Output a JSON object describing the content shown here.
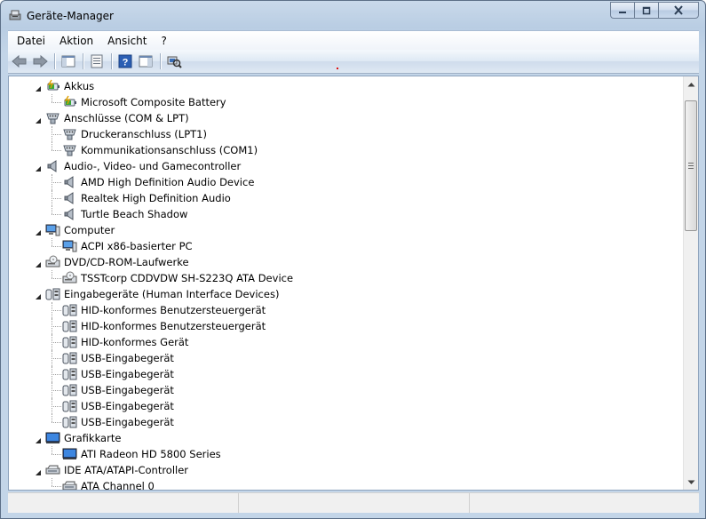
{
  "window": {
    "title": "Geräte-Manager"
  },
  "menu": [
    "Datei",
    "Aktion",
    "Ansicht",
    "?"
  ],
  "toolbar": [
    "back-icon",
    "forward-icon",
    "show-hide-console-tree-icon",
    "properties-icon",
    "help-icon",
    "show-action-pane-icon",
    "scan-hardware-icon"
  ],
  "tree": [
    {
      "label": "Akkus",
      "level": 0,
      "expanded": true,
      "icon": "battery"
    },
    {
      "label": "Microsoft Composite Battery",
      "level": 1,
      "icon": "battery"
    },
    {
      "label": "Anschlüsse (COM & LPT)",
      "level": 0,
      "expanded": true,
      "icon": "port"
    },
    {
      "label": "Druckeranschluss (LPT1)",
      "level": 1,
      "icon": "port"
    },
    {
      "label": "Kommunikationsanschluss (COM1)",
      "level": 1,
      "icon": "port"
    },
    {
      "label": "Audio-, Video- und Gamecontroller",
      "level": 0,
      "expanded": true,
      "icon": "speaker"
    },
    {
      "label": "AMD High Definition Audio Device",
      "level": 1,
      "icon": "speaker"
    },
    {
      "label": "Realtek High Definition Audio",
      "level": 1,
      "icon": "speaker"
    },
    {
      "label": "Turtle Beach Shadow",
      "level": 1,
      "icon": "speaker"
    },
    {
      "label": "Computer",
      "level": 0,
      "expanded": true,
      "icon": "computer"
    },
    {
      "label": "ACPI x86-basierter PC",
      "level": 1,
      "icon": "computer"
    },
    {
      "label": "DVD/CD-ROM-Laufwerke",
      "level": 0,
      "expanded": true,
      "icon": "drive"
    },
    {
      "label": "TSSTcorp CDDVDW SH-S223Q ATA Device",
      "level": 1,
      "icon": "drive"
    },
    {
      "label": "Eingabegeräte (Human Interface Devices)",
      "level": 0,
      "expanded": true,
      "icon": "hid"
    },
    {
      "label": "HID-konformes Benutzersteuergerät",
      "level": 1,
      "icon": "hid"
    },
    {
      "label": "HID-konformes Benutzersteuergerät",
      "level": 1,
      "icon": "hid"
    },
    {
      "label": "HID-konformes Gerät",
      "level": 1,
      "icon": "hid"
    },
    {
      "label": "USB-Eingabegerät",
      "level": 1,
      "icon": "hid"
    },
    {
      "label": "USB-Eingabegerät",
      "level": 1,
      "icon": "hid"
    },
    {
      "label": "USB-Eingabegerät",
      "level": 1,
      "icon": "hid"
    },
    {
      "label": "USB-Eingabegerät",
      "level": 1,
      "icon": "hid"
    },
    {
      "label": "USB-Eingabegerät",
      "level": 1,
      "icon": "hid"
    },
    {
      "label": "Grafikkarte",
      "level": 0,
      "expanded": true,
      "icon": "display"
    },
    {
      "label": "ATI Radeon HD 5800 Series",
      "level": 1,
      "icon": "display"
    },
    {
      "label": "IDE ATA/ATAPI-Controller",
      "level": 0,
      "expanded": true,
      "icon": "ide"
    },
    {
      "label": "ATA Channel 0",
      "level": 1,
      "icon": "ide"
    }
  ],
  "scroll": {
    "position": 0.0
  }
}
